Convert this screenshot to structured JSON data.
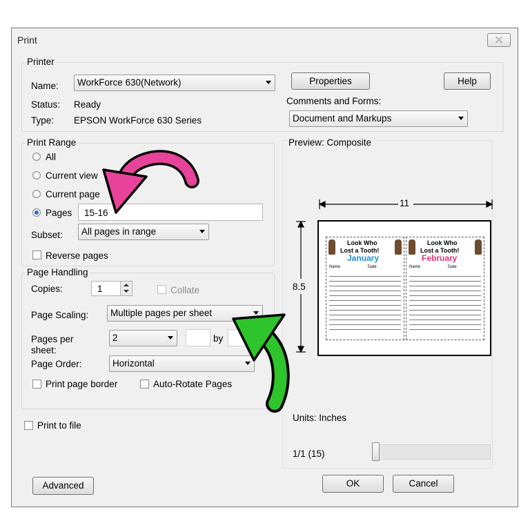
{
  "window": {
    "title": "Print",
    "close_glyph": "⤫"
  },
  "printer": {
    "group_label": "Printer",
    "name_label": "Name:",
    "name_value": "WorkForce 630(Network)",
    "status_label": "Status:",
    "status_value": "Ready",
    "type_label": "Type:",
    "type_value": "EPSON WorkForce 630 Series",
    "properties_button": "Properties",
    "help_button": "Help",
    "comments_label": "Comments and Forms:",
    "comments_value": "Document and Markups"
  },
  "print_range": {
    "group_label": "Print Range",
    "options": [
      {
        "label": "All",
        "selected": false
      },
      {
        "label": "Current view",
        "selected": false
      },
      {
        "label": "Current page",
        "selected": false
      },
      {
        "label": "Pages",
        "selected": true
      }
    ],
    "pages_value": "15-16",
    "subset_label": "Subset:",
    "subset_value": "All pages in range",
    "reverse_label": "Reverse pages"
  },
  "page_handling": {
    "group_label": "Page Handling",
    "copies_label": "Copies:",
    "copies_value": "1",
    "collate_label": "Collate",
    "scaling_label": "Page Scaling:",
    "scaling_value": "Multiple pages per sheet",
    "pps_label_line1": "Pages per",
    "pps_label_line2": "sheet:",
    "pps_value": "2",
    "by_label": "by",
    "order_label": "Page Order:",
    "order_value": "Horizontal",
    "border_label": "Print page border",
    "autorotate_label": "Auto-Rotate Pages"
  },
  "print_to_file_label": "Print to file",
  "preview": {
    "label": "Preview: Composite",
    "width_dim": "11",
    "height_dim": "8.5",
    "units": "Units: Inches",
    "page_indicator": "1/1 (15)",
    "pages": [
      {
        "line1": "Look Who",
        "line2": "Lost a Tooth!",
        "month": "January",
        "month_color": "#1f8fd6",
        "col1": "Name",
        "col2": "Date"
      },
      {
        "line1": "Look Who",
        "line2": "Lost a Tooth!",
        "month": "February",
        "month_color": "#e0337a",
        "col1": "Name",
        "col2": "Date"
      }
    ]
  },
  "buttons": {
    "advanced": "Advanced",
    "ok": "OK",
    "cancel": "Cancel"
  },
  "annotations": {
    "pink_arrow_color": "#e8439b",
    "green_arrow_color": "#2ec42b"
  }
}
